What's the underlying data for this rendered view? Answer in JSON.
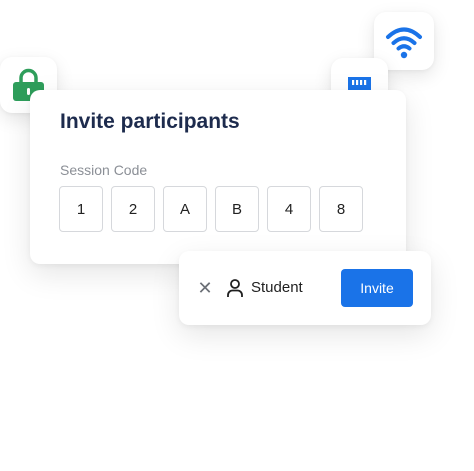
{
  "invite_card": {
    "title": "Invite participants",
    "session_code_label": "Session Code",
    "code_digits": [
      "1",
      "2",
      "A",
      "B",
      "4",
      "8"
    ]
  },
  "invite_bar": {
    "role_label": "Student",
    "invite_button_label": "Invite",
    "close_glyph": "✕"
  },
  "icons": {
    "lock": "lock-icon",
    "ethernet": "ethernet-icon",
    "wifi": "wifi-icon",
    "user": "user-icon",
    "close": "close-icon"
  },
  "colors": {
    "accent": "#1a73e8",
    "lock_green": "#2e9e5b",
    "title": "#1d2b4d"
  }
}
